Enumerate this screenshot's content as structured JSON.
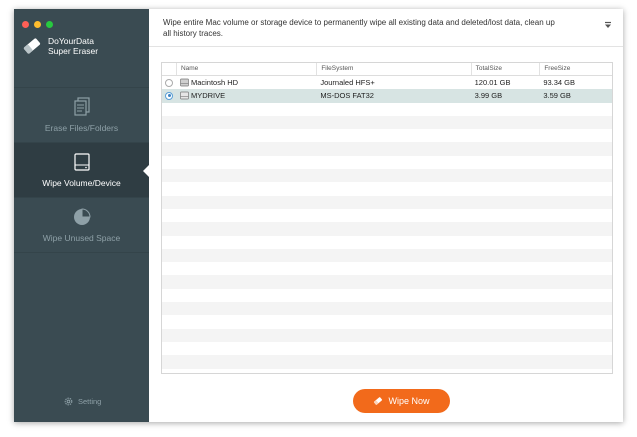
{
  "app": {
    "name_line1": "DoYourData",
    "name_line2": "Super Eraser",
    "traffic_colors": [
      "#ff5f56",
      "#ffbd2e",
      "#27c93f"
    ]
  },
  "sidebar": {
    "items": [
      {
        "label": "Erase Files/Folders",
        "icon": "documents-icon",
        "active": false
      },
      {
        "label": "Wipe Volume/Device",
        "icon": "drive-icon",
        "active": true
      },
      {
        "label": "Wipe Unused Space",
        "icon": "pie-chart-icon",
        "active": false
      }
    ],
    "setting_label": "Setting"
  },
  "main": {
    "description": "Wipe entire Mac volume or storage device to permanently wipe all existing data and deleted/lost data, clean up all history traces.",
    "table": {
      "columns": [
        "Name",
        "FileSystem",
        "TotalSize",
        "FreeSize"
      ],
      "rows": [
        {
          "name": "Macintosh HD",
          "filesystem": "Journaled HFS+",
          "total": "120.01 GB",
          "free": "93.34 GB",
          "selected": false
        },
        {
          "name": "MYDRIVE",
          "filesystem": "MS-DOS FAT32",
          "total": "3.99 GB",
          "free": "3.59 GB",
          "selected": true
        }
      ]
    },
    "wipe_button_label": "Wipe Now"
  },
  "colors": {
    "sidebar": "#3a4b52",
    "sidebar_active": "#2f3d43",
    "accent": "#f26a1b",
    "selected_row": "#d7e4e3"
  }
}
